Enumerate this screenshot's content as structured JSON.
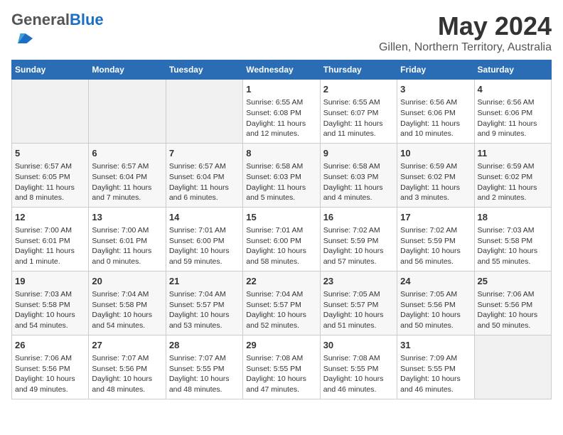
{
  "header": {
    "logo_general": "General",
    "logo_blue": "Blue",
    "main_title": "May 2024",
    "subtitle": "Gillen, Northern Territory, Australia"
  },
  "days_of_week": [
    "Sunday",
    "Monday",
    "Tuesday",
    "Wednesday",
    "Thursday",
    "Friday",
    "Saturday"
  ],
  "weeks": [
    {
      "row_bg": "#fff",
      "days": [
        {
          "num": "",
          "info": ""
        },
        {
          "num": "",
          "info": ""
        },
        {
          "num": "",
          "info": ""
        },
        {
          "num": "1",
          "info": "Sunrise: 6:55 AM\nSunset: 6:08 PM\nDaylight: 11 hours and 12 minutes."
        },
        {
          "num": "2",
          "info": "Sunrise: 6:55 AM\nSunset: 6:07 PM\nDaylight: 11 hours and 11 minutes."
        },
        {
          "num": "3",
          "info": "Sunrise: 6:56 AM\nSunset: 6:06 PM\nDaylight: 11 hours and 10 minutes."
        },
        {
          "num": "4",
          "info": "Sunrise: 6:56 AM\nSunset: 6:06 PM\nDaylight: 11 hours and 9 minutes."
        }
      ]
    },
    {
      "row_bg": "#f7f7f7",
      "days": [
        {
          "num": "5",
          "info": "Sunrise: 6:57 AM\nSunset: 6:05 PM\nDaylight: 11 hours and 8 minutes."
        },
        {
          "num": "6",
          "info": "Sunrise: 6:57 AM\nSunset: 6:04 PM\nDaylight: 11 hours and 7 minutes."
        },
        {
          "num": "7",
          "info": "Sunrise: 6:57 AM\nSunset: 6:04 PM\nDaylight: 11 hours and 6 minutes."
        },
        {
          "num": "8",
          "info": "Sunrise: 6:58 AM\nSunset: 6:03 PM\nDaylight: 11 hours and 5 minutes."
        },
        {
          "num": "9",
          "info": "Sunrise: 6:58 AM\nSunset: 6:03 PM\nDaylight: 11 hours and 4 minutes."
        },
        {
          "num": "10",
          "info": "Sunrise: 6:59 AM\nSunset: 6:02 PM\nDaylight: 11 hours and 3 minutes."
        },
        {
          "num": "11",
          "info": "Sunrise: 6:59 AM\nSunset: 6:02 PM\nDaylight: 11 hours and 2 minutes."
        }
      ]
    },
    {
      "row_bg": "#fff",
      "days": [
        {
          "num": "12",
          "info": "Sunrise: 7:00 AM\nSunset: 6:01 PM\nDaylight: 11 hours and 1 minute."
        },
        {
          "num": "13",
          "info": "Sunrise: 7:00 AM\nSunset: 6:01 PM\nDaylight: 11 hours and 0 minutes."
        },
        {
          "num": "14",
          "info": "Sunrise: 7:01 AM\nSunset: 6:00 PM\nDaylight: 10 hours and 59 minutes."
        },
        {
          "num": "15",
          "info": "Sunrise: 7:01 AM\nSunset: 6:00 PM\nDaylight: 10 hours and 58 minutes."
        },
        {
          "num": "16",
          "info": "Sunrise: 7:02 AM\nSunset: 5:59 PM\nDaylight: 10 hours and 57 minutes."
        },
        {
          "num": "17",
          "info": "Sunrise: 7:02 AM\nSunset: 5:59 PM\nDaylight: 10 hours and 56 minutes."
        },
        {
          "num": "18",
          "info": "Sunrise: 7:03 AM\nSunset: 5:58 PM\nDaylight: 10 hours and 55 minutes."
        }
      ]
    },
    {
      "row_bg": "#f7f7f7",
      "days": [
        {
          "num": "19",
          "info": "Sunrise: 7:03 AM\nSunset: 5:58 PM\nDaylight: 10 hours and 54 minutes."
        },
        {
          "num": "20",
          "info": "Sunrise: 7:04 AM\nSunset: 5:58 PM\nDaylight: 10 hours and 54 minutes."
        },
        {
          "num": "21",
          "info": "Sunrise: 7:04 AM\nSunset: 5:57 PM\nDaylight: 10 hours and 53 minutes."
        },
        {
          "num": "22",
          "info": "Sunrise: 7:04 AM\nSunset: 5:57 PM\nDaylight: 10 hours and 52 minutes."
        },
        {
          "num": "23",
          "info": "Sunrise: 7:05 AM\nSunset: 5:57 PM\nDaylight: 10 hours and 51 minutes."
        },
        {
          "num": "24",
          "info": "Sunrise: 7:05 AM\nSunset: 5:56 PM\nDaylight: 10 hours and 50 minutes."
        },
        {
          "num": "25",
          "info": "Sunrise: 7:06 AM\nSunset: 5:56 PM\nDaylight: 10 hours and 50 minutes."
        }
      ]
    },
    {
      "row_bg": "#fff",
      "days": [
        {
          "num": "26",
          "info": "Sunrise: 7:06 AM\nSunset: 5:56 PM\nDaylight: 10 hours and 49 minutes."
        },
        {
          "num": "27",
          "info": "Sunrise: 7:07 AM\nSunset: 5:56 PM\nDaylight: 10 hours and 48 minutes."
        },
        {
          "num": "28",
          "info": "Sunrise: 7:07 AM\nSunset: 5:55 PM\nDaylight: 10 hours and 48 minutes."
        },
        {
          "num": "29",
          "info": "Sunrise: 7:08 AM\nSunset: 5:55 PM\nDaylight: 10 hours and 47 minutes."
        },
        {
          "num": "30",
          "info": "Sunrise: 7:08 AM\nSunset: 5:55 PM\nDaylight: 10 hours and 46 minutes."
        },
        {
          "num": "31",
          "info": "Sunrise: 7:09 AM\nSunset: 5:55 PM\nDaylight: 10 hours and 46 minutes."
        },
        {
          "num": "",
          "info": ""
        }
      ]
    }
  ]
}
